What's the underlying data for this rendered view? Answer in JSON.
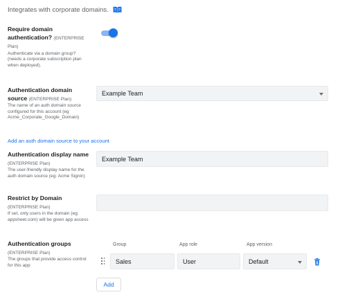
{
  "intro": {
    "text": "Integrates with corporate domains."
  },
  "require_auth": {
    "label": "Require domain authentication?",
    "plan": "(ENTERPRISE Plan)",
    "description": "Authenticate via a domain group? (needs a corporate subscription plan when deployed).",
    "enabled": true
  },
  "auth_source": {
    "label": "Authentication domain source",
    "plan": "(ENTERPRISE Plan)",
    "description": "The name of an auth domain source configured for this account (eg Acme_Corporate_Google_Domain)",
    "value": "Example Team"
  },
  "add_source_link": "Add an auth domain source to your account",
  "display_name": {
    "label": "Authentication display name",
    "plan": "(ENTERPRISE Plan)",
    "description": "The user-friendly display name for the auth domain source (eg: Acme Signin)",
    "value": "Example Team"
  },
  "restrict_domain": {
    "label": "Restrict by Domain",
    "plan": "(ENTERPRISE Plan)",
    "description": "If set, only users in the domain (eg: appsheet.com) will be given app access",
    "value": ""
  },
  "auth_groups": {
    "label": "Authentication groups",
    "plan": "(ENTERPRISE Plan)",
    "description": "The groups that provide access control for this app",
    "columns": [
      "Group",
      "App role",
      "App version"
    ],
    "rows": [
      {
        "group": "Sales",
        "role": "User",
        "version": "Default"
      }
    ],
    "add_label": "Add"
  },
  "colors": {
    "accent": "#1a73e8",
    "toggle_track": "#8ab4f8",
    "field_bg": "#f1f3f4"
  },
  "icons": [
    "book-icon",
    "drag-handle-icon",
    "trash-icon",
    "chevron-down-icon"
  ]
}
